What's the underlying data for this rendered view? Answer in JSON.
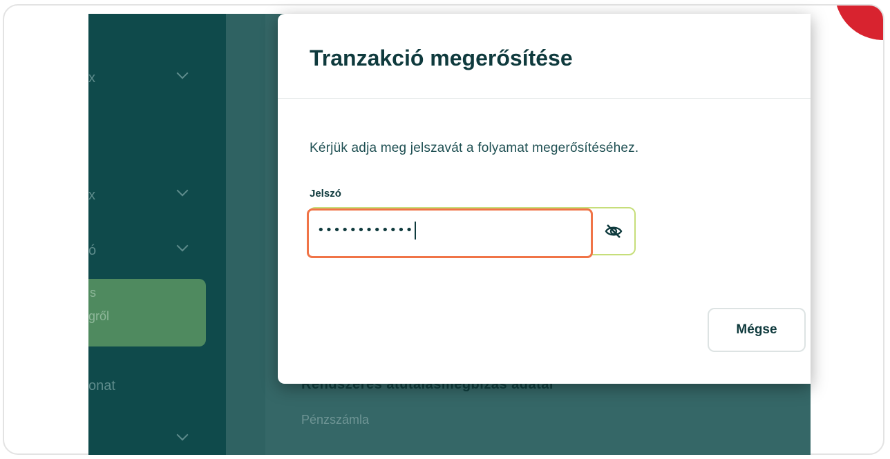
{
  "sidebar": {
    "items": [
      {
        "label": "x"
      },
      {
        "label": "x"
      },
      {
        "label": "ó"
      }
    ],
    "active": {
      "line1": "s",
      "line2": "gről"
    },
    "bottom_item": {
      "label": "onat"
    }
  },
  "background": {
    "section_title": "Rendszeres átutalásmegbízás adatai",
    "field_label": "Pénzszámla"
  },
  "modal": {
    "title": "Tranzakció megerősítése",
    "message": "Kérjük adja meg jelszavát a folyamat megerősítéséhez.",
    "password_label": "Jelszó",
    "password_value": "••••••••••••",
    "cancel_label": "Mégse"
  },
  "icons": {
    "toggle_visibility": "eye-slash-icon"
  },
  "colors": {
    "brand_dark": "#0f4a4b",
    "focus_outline": "#f07447",
    "field_border": "#c6de7a",
    "accent_corner": "#d8232f"
  }
}
